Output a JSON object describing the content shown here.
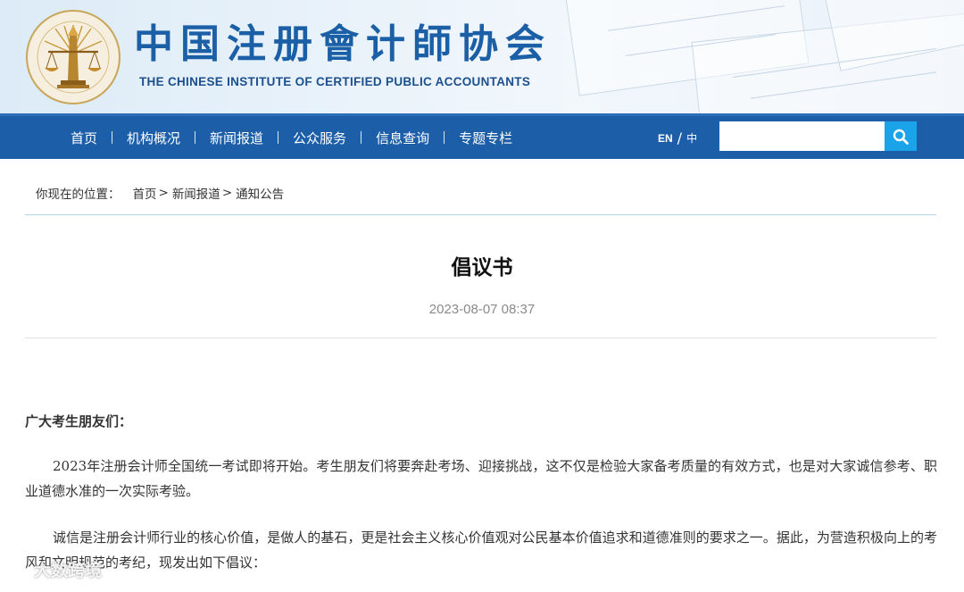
{
  "header": {
    "title_cn": "中国注册會计師协会",
    "title_en": "THE CHINESE INSTITUTE OF CERTIFIED PUBLIC ACCOUNTANTS",
    "logo_icon": "cicpa-emblem-icon",
    "brand_color": "#1c5ea8"
  },
  "nav": {
    "items": [
      {
        "label": "首页"
      },
      {
        "label": "机构概况"
      },
      {
        "label": "新闻报道"
      },
      {
        "label": "公众服务"
      },
      {
        "label": "信息查询"
      },
      {
        "label": "专题专栏"
      }
    ],
    "lang_en": "EN",
    "lang_sep": "/",
    "lang_zh": "中",
    "search": {
      "value": "",
      "placeholder": "",
      "icon": "search-icon",
      "button_color": "#1aa3e8"
    }
  },
  "breadcrumb": {
    "label": "你现在的位置：",
    "items": [
      "首页",
      "新闻报道",
      "通知公告"
    ],
    "arrow": ">"
  },
  "article": {
    "title": "倡议书",
    "date": "2023-08-07 08:37",
    "salutation": "广大考生朋友们：",
    "paragraphs": [
      "2023年注册会计师全国统一考试即将开始。考生朋友们将要奔赴考场、迎接挑战，这不仅是检验大家备考质量的有效方式，也是对大家诚信参考、职业道德水准的一次实际考验。",
      "诚信是注册会计师行业的核心价值，是做人的基石，更是社会主义核心价值观对公民基本价值追求和道德准则的要求之一。据此，为营造积极向上的考风和文明规范的考纪，现发出如下倡议："
    ]
  },
  "watermark": {
    "text": "大数跨境",
    "icon": "watermark-logo-icon"
  }
}
